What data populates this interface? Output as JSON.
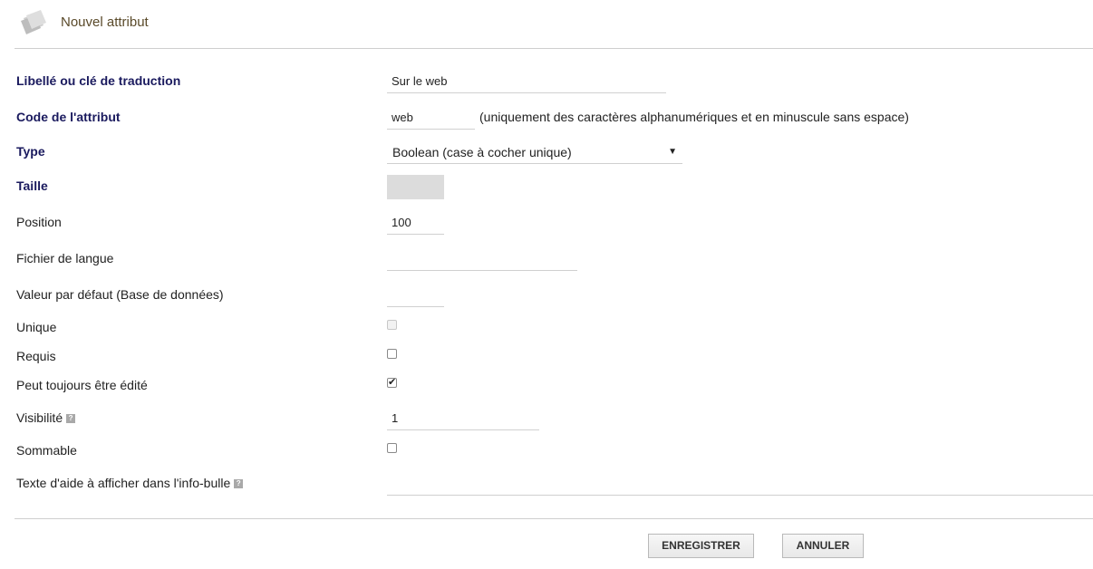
{
  "header": {
    "title": "Nouvel attribut",
    "icon": "folder-icon"
  },
  "fields": {
    "label": {
      "label": "Libellé ou clé de traduction",
      "value": "Sur le web"
    },
    "code": {
      "label": "Code de l'attribut",
      "value": "web",
      "hint": "(uniquement des caractères alphanumériques et en minuscule sans espace)"
    },
    "type": {
      "label": "Type",
      "selected": "Boolean (case à cocher unique)"
    },
    "size": {
      "label": "Taille",
      "value": ""
    },
    "position": {
      "label": "Position",
      "value": "100"
    },
    "langfile": {
      "label": "Fichier de langue",
      "value": ""
    },
    "default": {
      "label": "Valeur par défaut (Base de données)",
      "value": ""
    },
    "unique": {
      "label": "Unique",
      "checked": false,
      "disabled": true
    },
    "required": {
      "label": "Requis",
      "checked": false
    },
    "always_editable": {
      "label": "Peut toujours être édité",
      "checked": true
    },
    "visibility": {
      "label": "Visibilité",
      "value": "1"
    },
    "summable": {
      "label": "Sommable",
      "checked": false
    },
    "help_text": {
      "label": "Texte d'aide à afficher dans l'info-bulle",
      "value": ""
    }
  },
  "buttons": {
    "save": "ENREGISTRER",
    "cancel": "ANNULER"
  },
  "help_icon": "?"
}
